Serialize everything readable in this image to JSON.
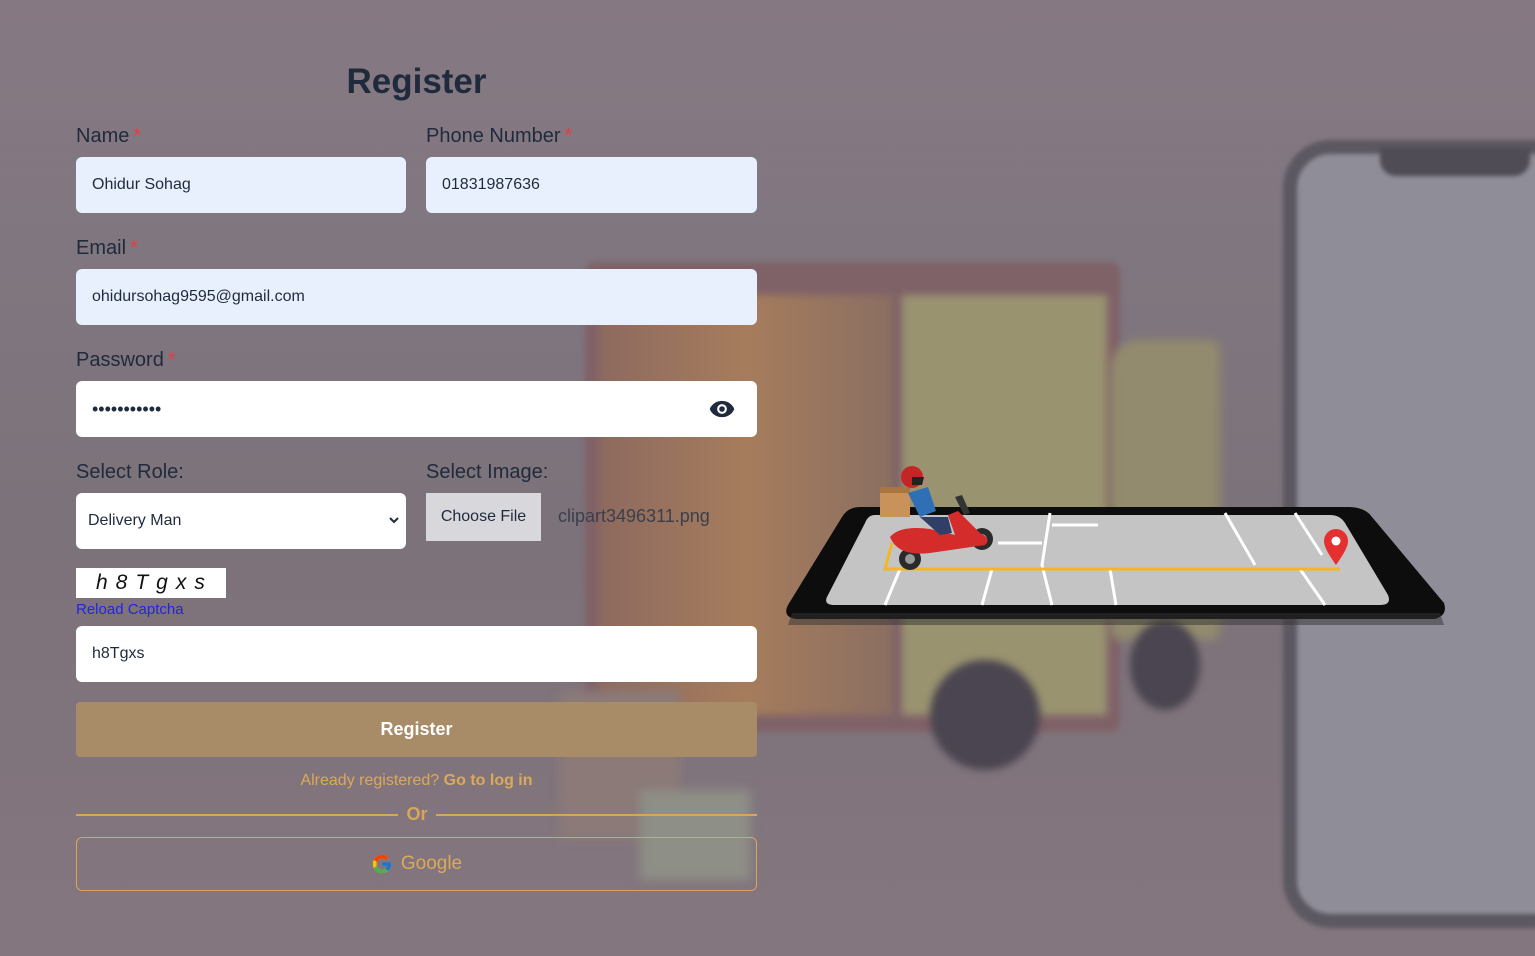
{
  "form": {
    "title": "Register",
    "name": {
      "label": "Name",
      "required": "*",
      "value": "Ohidur Sohag"
    },
    "phone": {
      "label": "Phone Number",
      "required": "*",
      "value": "01831987636"
    },
    "email": {
      "label": "Email",
      "required": "*",
      "value": "ohidursohag9595@gmail.com"
    },
    "password": {
      "label": "Password",
      "required": "*",
      "value": "•••••••••••"
    },
    "role": {
      "label": "Select Role:",
      "selected": "Delivery Man"
    },
    "image": {
      "label": "Select Image:",
      "button": "Choose File",
      "file_name": "clipart3496311.png"
    },
    "captcha": {
      "text": "h8Tgxs",
      "reload": "Reload Captcha",
      "input_value": "h8Tgxs"
    },
    "submit": "Register",
    "login_prompt": "Already registered?",
    "login_link": "Go to log in",
    "divider": "Or",
    "google": "Google"
  },
  "icons": {
    "password_toggle": "eye-icon",
    "select_arrow": "chevron-down-icon",
    "google_logo": "google-icon",
    "illustration": "delivery-scooter-phone-illustration"
  },
  "colors": {
    "accent": "#d9a659",
    "register_button": "#a88c68",
    "required": "#e14141",
    "link": "#2323e6",
    "autofill": "#e8f0fe"
  }
}
